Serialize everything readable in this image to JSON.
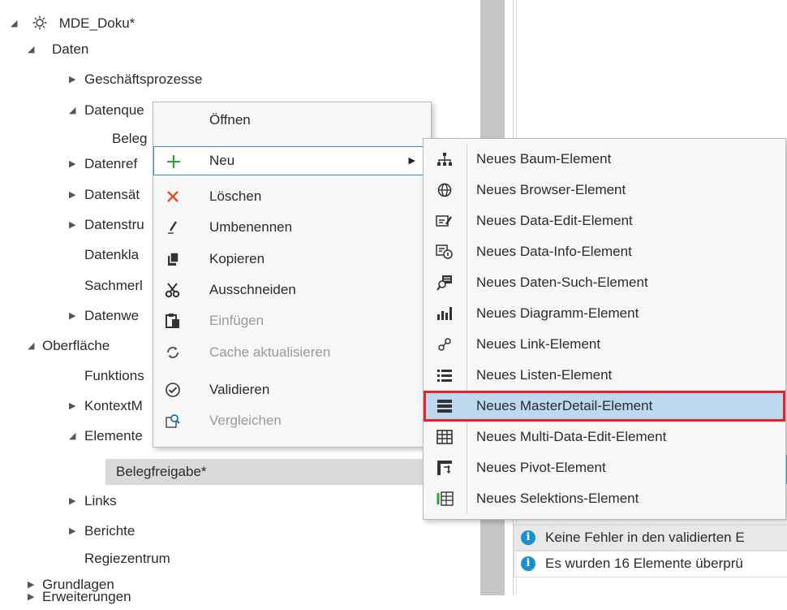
{
  "tree": {
    "root": "MDE_Doku*",
    "daten": "Daten",
    "geschaeftsprozesse": "Geschäftsprozesse",
    "datenquellen": "Datenque",
    "beleg": "Beleg",
    "datenreferenzen": "Datenref",
    "datensaetze": "Datensät",
    "datenstrukturen": "Datenstru",
    "datenklassen": "Datenkla",
    "sachmerkmale": "Sachmerl",
    "datenwerte": "Datenwe",
    "oberflaeche": "Oberfläche",
    "funktionen": "Funktions",
    "kontextmenue": "KontextM",
    "elemente": "Elemente",
    "belegfreigabe": "Belegfreigabe*",
    "links": "Links",
    "berichte": "Berichte",
    "regiezentrum": "Regiezentrum",
    "grundlagen": "Grundlagen",
    "erweiterungen": "Erweiterungen"
  },
  "context_menu": {
    "items": [
      {
        "label": "Öffnen",
        "icon": "none"
      },
      {
        "label": "Neu",
        "icon": "plus-icon"
      },
      {
        "label": "Löschen",
        "icon": "delete-x-icon"
      },
      {
        "label": "Umbenennen",
        "icon": "pencil-icon"
      },
      {
        "label": "Kopieren",
        "icon": "copy-icon"
      },
      {
        "label": "Ausschneiden",
        "icon": "scissors-icon"
      },
      {
        "label": "Einfügen",
        "icon": "paste-icon"
      },
      {
        "label": "Cache aktualisieren",
        "icon": "refresh-icon"
      },
      {
        "label": "Validieren",
        "icon": "check-circle-icon"
      },
      {
        "label": "Vergleichen",
        "icon": "compare-icon"
      }
    ]
  },
  "submenu": {
    "items": [
      {
        "label": "Neues Baum-Element",
        "icon": "tree-icon"
      },
      {
        "label": "Neues Browser-Element",
        "icon": "globe-icon"
      },
      {
        "label": "Neues Data-Edit-Element",
        "icon": "data-edit-icon"
      },
      {
        "label": "Neues Data-Info-Element",
        "icon": "data-info-icon"
      },
      {
        "label": "Neues Daten-Such-Element",
        "icon": "data-search-icon"
      },
      {
        "label": "Neues Diagramm-Element",
        "icon": "bar-chart-icon"
      },
      {
        "label": "Neues Link-Element",
        "icon": "link-icon"
      },
      {
        "label": "Neues Listen-Element",
        "icon": "list-icon"
      },
      {
        "label": "Neues MasterDetail-Element",
        "icon": "master-detail-icon"
      },
      {
        "label": "Neues Multi-Data-Edit-Element",
        "icon": "grid-icon"
      },
      {
        "label": "Neues Pivot-Element",
        "icon": "pivot-icon"
      },
      {
        "label": "Neues Selektions-Element",
        "icon": "selection-icon"
      }
    ]
  },
  "messages": [
    {
      "text": "Keine Fehler in den validierten E",
      "icon": "info-icon"
    },
    {
      "text": "Es wurden 16 Elemente überprü",
      "icon": "info-icon"
    }
  ],
  "colors": {
    "accent": "#2f8fd8",
    "highlight_border": "#e8202a",
    "info_blue": "#1b8fd6",
    "plus_green": "#2aa52a",
    "delete_red": "#e0502a"
  }
}
